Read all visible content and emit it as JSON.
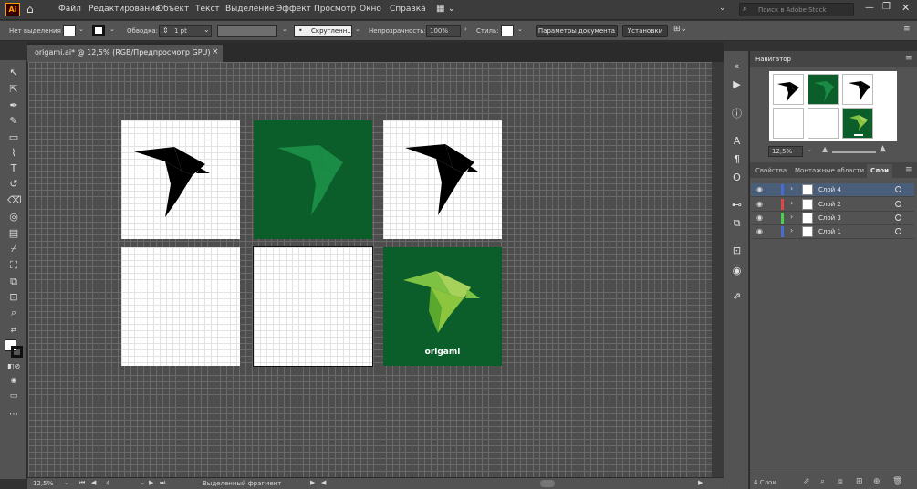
{
  "app": {
    "logo": "Ai"
  },
  "menubar": {
    "items": [
      "Файл",
      "Редактирование",
      "Объект",
      "Текст",
      "Выделение",
      "Эффект",
      "Просмотр",
      "Окно",
      "Справка"
    ],
    "search_placeholder": "Поиск в Adobe Stock"
  },
  "control": {
    "no_selection": "Нет выделения",
    "stroke_label": "Обводка:",
    "stroke_value": "1 pt",
    "brush_value": "Скругленн...",
    "opacity_label": "Непрозрачность:",
    "opacity_value": "100%",
    "style_label": "Стиль:",
    "doc_settings": "Параметры документа",
    "preferences": "Установки"
  },
  "document": {
    "tab_title": "origami.ai* @ 12,5% (RGB/Предпросмотр GPU)",
    "close": "×"
  },
  "artboards": {
    "brand_text": "origami"
  },
  "status": {
    "zoom": "12,5%",
    "artboard_number": "4",
    "info": "Выделенный фрагмент"
  },
  "navigator": {
    "title": "Навигатор",
    "zoom": "12,5%"
  },
  "panels": {
    "tabs": [
      "Свойства",
      "Монтажные области",
      "Слои"
    ]
  },
  "layers": {
    "items": [
      {
        "name": "Слой 4",
        "color": "#4a6cd0",
        "active": true
      },
      {
        "name": "Слой 2",
        "color": "#e04848",
        "active": false
      },
      {
        "name": "Слой 3",
        "color": "#4ad04a",
        "active": false
      },
      {
        "name": "Слой 1",
        "color": "#4a6cd0",
        "active": false
      }
    ],
    "count": "4 Слои"
  },
  "colors": {
    "artboard_green": "#0b5e2a",
    "bird_light_green": "#7dc242",
    "bird_mid_green": "#1a8c45"
  }
}
